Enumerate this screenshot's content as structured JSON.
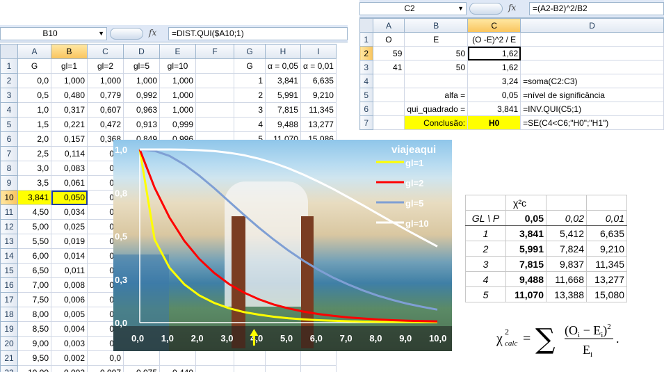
{
  "left": {
    "name_box": "B10",
    "formula": "=DIST.QUI($A10;1)",
    "columns": [
      "A",
      "B",
      "C",
      "D",
      "E",
      "F",
      "G",
      "H",
      "I"
    ],
    "rows": [
      {
        "n": "1",
        "cells": [
          "G",
          "gl=1",
          "gl=2",
          "gl=5",
          "gl=10",
          "",
          "G",
          "α = 0,05",
          "α = 0,01"
        ]
      },
      {
        "n": "2",
        "cells": [
          "0,0",
          "1,000",
          "1,000",
          "1,000",
          "1,000",
          "",
          "1",
          "3,841",
          "6,635"
        ]
      },
      {
        "n": "3",
        "cells": [
          "0,5",
          "0,480",
          "0,779",
          "0,992",
          "1,000",
          "",
          "2",
          "5,991",
          "9,210"
        ]
      },
      {
        "n": "4",
        "cells": [
          "1,0",
          "0,317",
          "0,607",
          "0,963",
          "1,000",
          "",
          "3",
          "7,815",
          "11,345"
        ]
      },
      {
        "n": "5",
        "cells": [
          "1,5",
          "0,221",
          "0,472",
          "0,913",
          "0,999",
          "",
          "4",
          "9,488",
          "13,277"
        ]
      },
      {
        "n": "6",
        "cells": [
          "2,0",
          "0,157",
          "0,368",
          "0,849",
          "0,996",
          "",
          "5",
          "11,070",
          "15,086"
        ]
      },
      {
        "n": "7",
        "cells": [
          "2,5",
          "0,114",
          "0,2",
          "",
          "",
          "",
          "",
          "",
          ""
        ]
      },
      {
        "n": "8",
        "cells": [
          "3,0",
          "0,083",
          "0,2",
          "",
          "",
          "",
          "",
          "",
          ""
        ]
      },
      {
        "n": "9",
        "cells": [
          "3,5",
          "0,061",
          "0,1",
          "",
          "",
          "",
          "",
          "",
          ""
        ]
      },
      {
        "n": "10",
        "cells": [
          "3,841",
          "0,050",
          "0,1",
          "",
          "",
          "",
          "",
          "",
          ""
        ]
      },
      {
        "n": "11",
        "cells": [
          "4,50",
          "0,034",
          "0,1",
          "",
          "",
          "",
          "",
          "",
          ""
        ]
      },
      {
        "n": "12",
        "cells": [
          "5,00",
          "0,025",
          "0,0",
          "",
          "",
          "",
          "",
          "",
          ""
        ]
      },
      {
        "n": "13",
        "cells": [
          "5,50",
          "0,019",
          "0,0",
          "",
          "",
          "",
          "",
          "",
          ""
        ]
      },
      {
        "n": "14",
        "cells": [
          "6,00",
          "0,014",
          "0,0",
          "",
          "",
          "",
          "",
          "",
          ""
        ]
      },
      {
        "n": "15",
        "cells": [
          "6,50",
          "0,011",
          "0,0",
          "",
          "",
          "",
          "",
          "",
          ""
        ]
      },
      {
        "n": "16",
        "cells": [
          "7,00",
          "0,008",
          "0,0",
          "",
          "",
          "",
          "",
          "",
          ""
        ]
      },
      {
        "n": "17",
        "cells": [
          "7,50",
          "0,006",
          "0,0",
          "",
          "",
          "",
          "",
          "",
          ""
        ]
      },
      {
        "n": "18",
        "cells": [
          "8,00",
          "0,005",
          "0,0",
          "",
          "",
          "",
          "",
          "",
          ""
        ]
      },
      {
        "n": "19",
        "cells": [
          "8,50",
          "0,004",
          "0,0",
          "",
          "",
          "",
          "",
          "",
          ""
        ]
      },
      {
        "n": "20",
        "cells": [
          "9,00",
          "0,003",
          "0,0",
          "",
          "",
          "",
          "",
          "",
          ""
        ]
      },
      {
        "n": "21",
        "cells": [
          "9,50",
          "0,002",
          "0,0",
          "",
          "",
          "",
          "",
          "",
          ""
        ]
      },
      {
        "n": "22",
        "cells": [
          "10,00",
          "0,002",
          "0,007",
          "0,075",
          "0,440",
          "",
          "",
          "",
          ""
        ]
      }
    ]
  },
  "right": {
    "name_box": "C2",
    "formula": "=(A2-B2)^2/B2",
    "columns": [
      "A",
      "B",
      "C",
      "D"
    ],
    "rows": [
      {
        "n": "1",
        "cells": [
          "O",
          "E",
          "(O -E)^2 / E",
          ""
        ]
      },
      {
        "n": "2",
        "cells": [
          "59",
          "50",
          "1,62",
          ""
        ]
      },
      {
        "n": "3",
        "cells": [
          "41",
          "50",
          "1,62",
          ""
        ]
      },
      {
        "n": "4",
        "cells": [
          "",
          "",
          "3,24",
          "=soma(C2:C3)"
        ]
      },
      {
        "n": "5",
        "cells": [
          "",
          "alfa =",
          "0,05",
          "=nível de significância"
        ]
      },
      {
        "n": "6",
        "cells": [
          "",
          "qui_quadrado =",
          "3,841",
          "=INV.QUI(C5;1)"
        ]
      },
      {
        "n": "7",
        "cells": [
          "",
          "Conclusão:",
          "H0",
          "=SE(C4<C6;\"H0\";\"H1\")"
        ]
      }
    ]
  },
  "chart_data": {
    "type": "line",
    "x": [
      0,
      0.5,
      1,
      1.5,
      2,
      2.5,
      3,
      3.5,
      4,
      4.5,
      5,
      5.5,
      6,
      6.5,
      7,
      7.5,
      8,
      8.5,
      9,
      9.5,
      10
    ],
    "series": [
      {
        "name": "gl=1",
        "color": "#ffff00",
        "values": [
          1,
          0.48,
          0.317,
          0.221,
          0.157,
          0.114,
          0.083,
          0.061,
          0.046,
          0.034,
          0.025,
          0.019,
          0.014,
          0.011,
          0.008,
          0.006,
          0.005,
          0.004,
          0.003,
          0.002,
          0.002
        ]
      },
      {
        "name": "gl=2",
        "color": "#ff0000",
        "values": [
          1,
          0.779,
          0.607,
          0.472,
          0.368,
          0.287,
          0.223,
          0.174,
          0.135,
          0.105,
          0.082,
          0.064,
          0.05,
          0.039,
          0.03,
          0.024,
          0.018,
          0.014,
          0.011,
          0.009,
          0.007
        ]
      },
      {
        "name": "gl=5",
        "color": "#7f9fd4",
        "values": [
          1,
          0.992,
          0.963,
          0.913,
          0.849,
          0.777,
          0.7,
          0.623,
          0.549,
          0.48,
          0.416,
          0.358,
          0.306,
          0.26,
          0.221,
          0.186,
          0.156,
          0.131,
          0.109,
          0.091,
          0.075
        ]
      },
      {
        "name": "gl=10",
        "color": "#ffffff",
        "values": [
          1,
          1,
          1,
          0.999,
          0.996,
          0.991,
          0.981,
          0.967,
          0.947,
          0.922,
          0.891,
          0.855,
          0.815,
          0.772,
          0.725,
          0.678,
          0.629,
          0.58,
          0.532,
          0.486,
          0.44
        ]
      }
    ],
    "ylim": [
      0,
      1
    ],
    "yticks": [
      "0,0",
      "0,3",
      "0,5",
      "0,8",
      "1,0"
    ],
    "yticks_values": [
      0,
      0.25,
      0.5,
      0.75,
      1
    ],
    "xticks": [
      "0,0",
      "1,0",
      "2,0",
      "3,0",
      "4,0",
      "5,0",
      "6,0",
      "7,0",
      "8,0",
      "9,0",
      "10,0"
    ],
    "xlim": [
      0,
      10
    ],
    "marker_x": 3.841,
    "marker_color": "#ffff00",
    "watermark": "viajeaqui",
    "legend_position": "top-right"
  },
  "chi_table": {
    "symbol": "χ²c",
    "header": [
      "GL \\ P",
      "0,05",
      "0,02",
      "0,01"
    ],
    "rows": [
      [
        "1",
        "3,841",
        "5,412",
        "6,635"
      ],
      [
        "2",
        "5,991",
        "7,824",
        "9,210"
      ],
      [
        "3",
        "7,815",
        "9,837",
        "11,345"
      ],
      [
        "4",
        "9,488",
        "11,668",
        "13,277"
      ],
      [
        "5",
        "11,070",
        "13,388",
        "15,080"
      ]
    ]
  },
  "formula": {
    "lhs": "χ",
    "lhs_sup": "2",
    "lhs_sub": "calc",
    "equals": "=",
    "sum": "∑",
    "numerator": "(O",
    "numerator_i": "i",
    "numerator_mid": " − E",
    "numerator_i2": "i",
    "numerator_close": ")",
    "numerator_sup": "2",
    "denominator": "E",
    "denominator_i": "i",
    "trailing": "."
  }
}
